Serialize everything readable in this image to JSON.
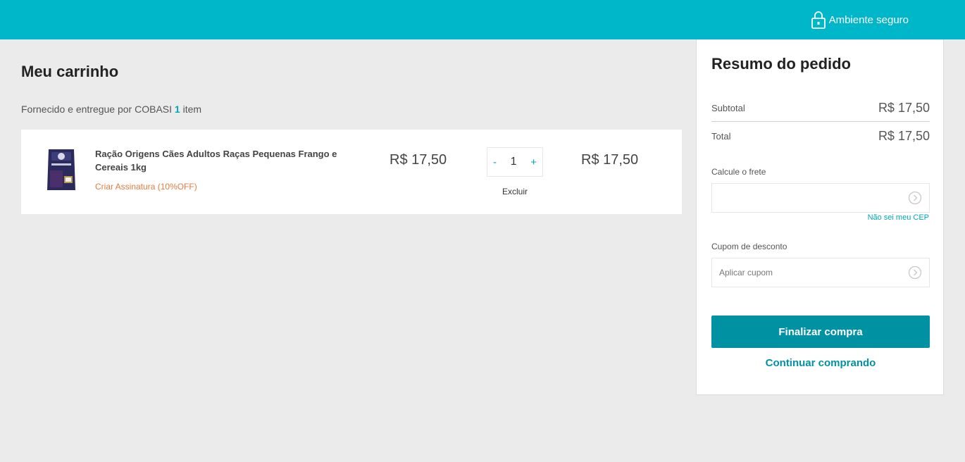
{
  "header": {
    "secure_label": "Ambiente seguro",
    "secure_icon": "lock-icon",
    "brand_color": "#00b7c9"
  },
  "cart": {
    "title": "Meu carrinho",
    "supplier_text": "Fornecido e entregue por COBASI",
    "item_count": "1",
    "item_word": "item",
    "items": [
      {
        "name": "Ração Origens Cães Adultos Raças Pequenas Frango e Cereais 1kg",
        "subscription_label": "Criar Assinatura (10%OFF)",
        "unit_price": "R$ 17,50",
        "quantity": "1",
        "decrease_label": "-",
        "increase_label": "+",
        "remove_label": "Excluir",
        "total_price": "R$ 17,50",
        "image_icon": "pet-food-bag-image"
      }
    ]
  },
  "summary": {
    "title": "Resumo do pedido",
    "subtotal_label": "Subtotal",
    "subtotal_value": "R$ 17,50",
    "total_label": "Total",
    "total_value": "R$ 17,50",
    "shipping_label": "Calcule o frete",
    "shipping_placeholder": "",
    "shipping_help_link": "Não sei meu CEP",
    "coupon_label": "Cupom de desconto",
    "coupon_placeholder": "Aplicar cupom",
    "checkout_button": "Finalizar compra",
    "continue_link": "Continuar comprando",
    "accent_color": "#0092a3",
    "subscription_color": "#e07d3c"
  }
}
